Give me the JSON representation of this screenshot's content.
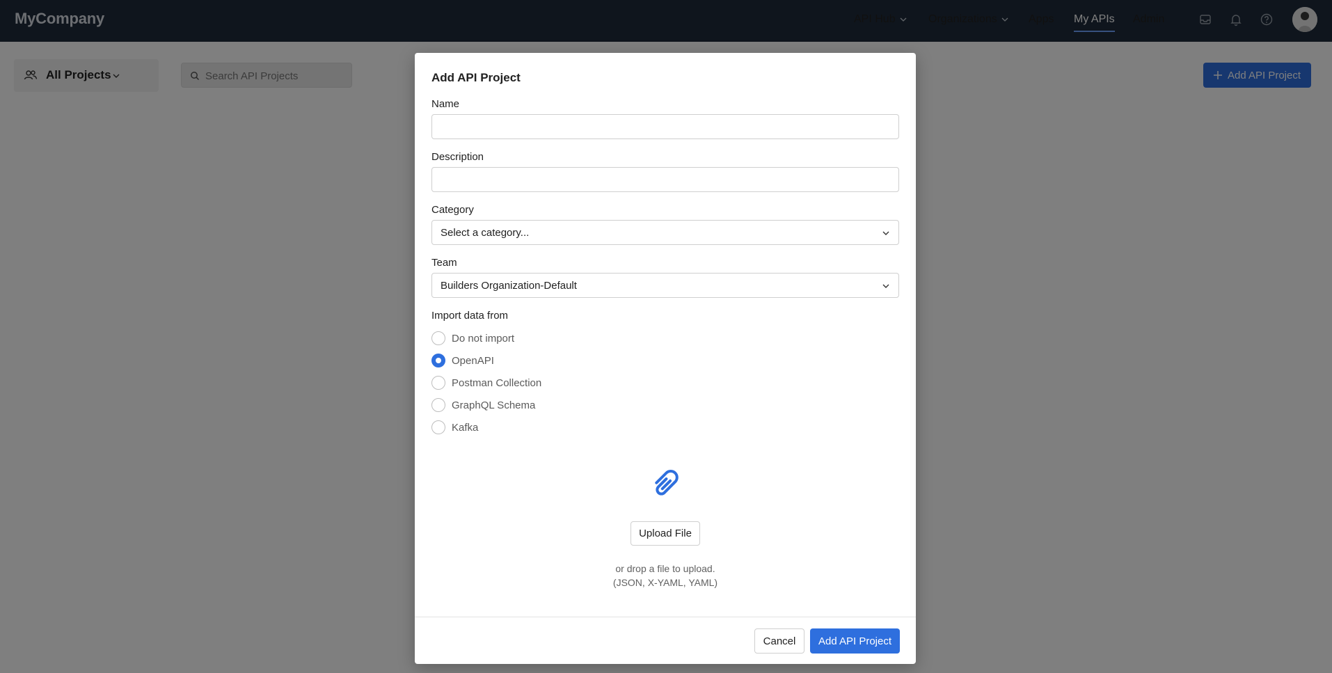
{
  "app": {
    "brand": "MyCompany"
  },
  "nav": {
    "items": [
      {
        "label": "API Hub",
        "has_dropdown": true
      },
      {
        "label": "Organizations",
        "has_dropdown": true
      },
      {
        "label": "Apps",
        "has_dropdown": false
      },
      {
        "label": "My APIs",
        "has_dropdown": false,
        "active": true
      },
      {
        "label": "Admin",
        "has_dropdown": false
      }
    ],
    "icons": [
      "inbox-icon",
      "bell-icon",
      "help-icon"
    ]
  },
  "toolbar": {
    "project_filter": "All Projects",
    "search_placeholder": "Search API Projects",
    "add_button": "Add API Project"
  },
  "modal": {
    "title": "Add API Project",
    "name_label": "Name",
    "name_value": "",
    "description_label": "Description",
    "description_value": "",
    "category_label": "Category",
    "category_value": "Select a category...",
    "team_label": "Team",
    "team_value": "Builders Organization-Default",
    "import_label": "Import data from",
    "import_options": [
      {
        "label": "Do not import",
        "checked": false
      },
      {
        "label": "OpenAPI",
        "checked": true
      },
      {
        "label": "Postman Collection",
        "checked": false
      },
      {
        "label": "GraphQL Schema",
        "checked": false
      },
      {
        "label": "Kafka",
        "checked": false
      }
    ],
    "upload_button": "Upload File",
    "upload_hint_1": "or drop a file to upload.",
    "upload_hint_2": "(JSON, X-YAML, YAML)",
    "cancel_button": "Cancel",
    "submit_button": "Add API Project"
  },
  "colors": {
    "topbar": "#1f2b3a",
    "accent": "#2e6fde"
  }
}
